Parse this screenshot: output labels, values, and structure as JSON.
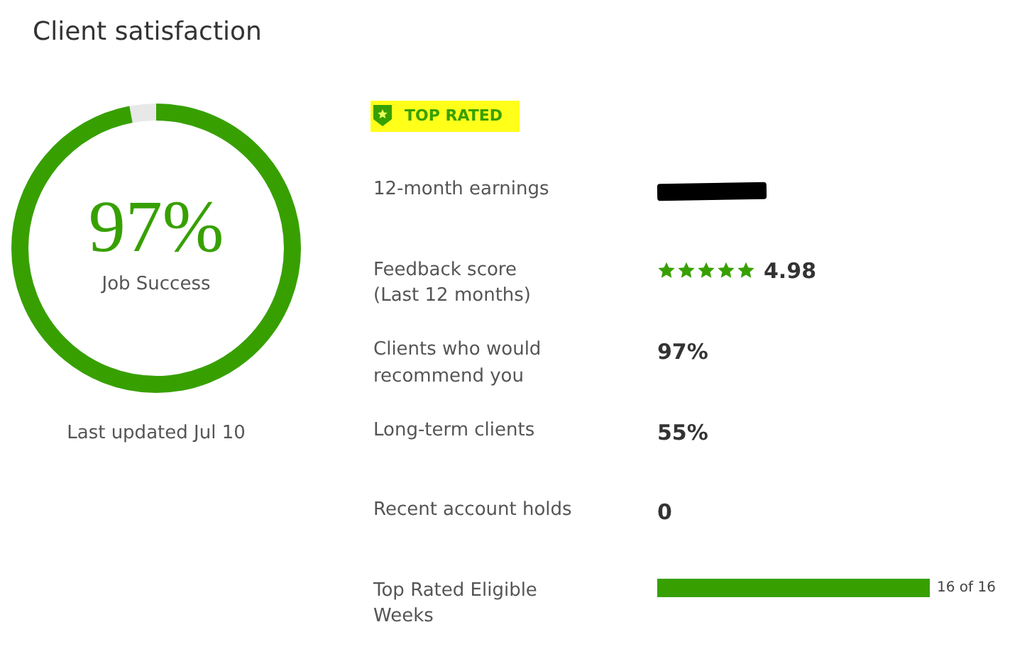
{
  "title": "Client satisfaction",
  "job_success": {
    "value": "97%",
    "label": "Job Success",
    "level": 0.97,
    "updated": "Last updated Jul 10"
  },
  "badge": {
    "label": "TOP RATED",
    "highlighted": true
  },
  "metrics": [
    {
      "kind": "redacted",
      "label": "12-month earnings"
    },
    {
      "kind": "rating",
      "label": "Feedback score",
      "sublabel": "(Last 12 months)",
      "stars": 5,
      "value": "4.98"
    },
    {
      "kind": "text",
      "label": "Clients who would recommend you",
      "value": "97%"
    },
    {
      "kind": "text",
      "label": "Long-term clients",
      "value": "55%"
    },
    {
      "kind": "text",
      "label": "Recent account holds",
      "value": "0"
    },
    {
      "kind": "bar",
      "label": "Top Rated Eligible Weeks",
      "level": 1,
      "value": "16 of 16"
    }
  ]
}
